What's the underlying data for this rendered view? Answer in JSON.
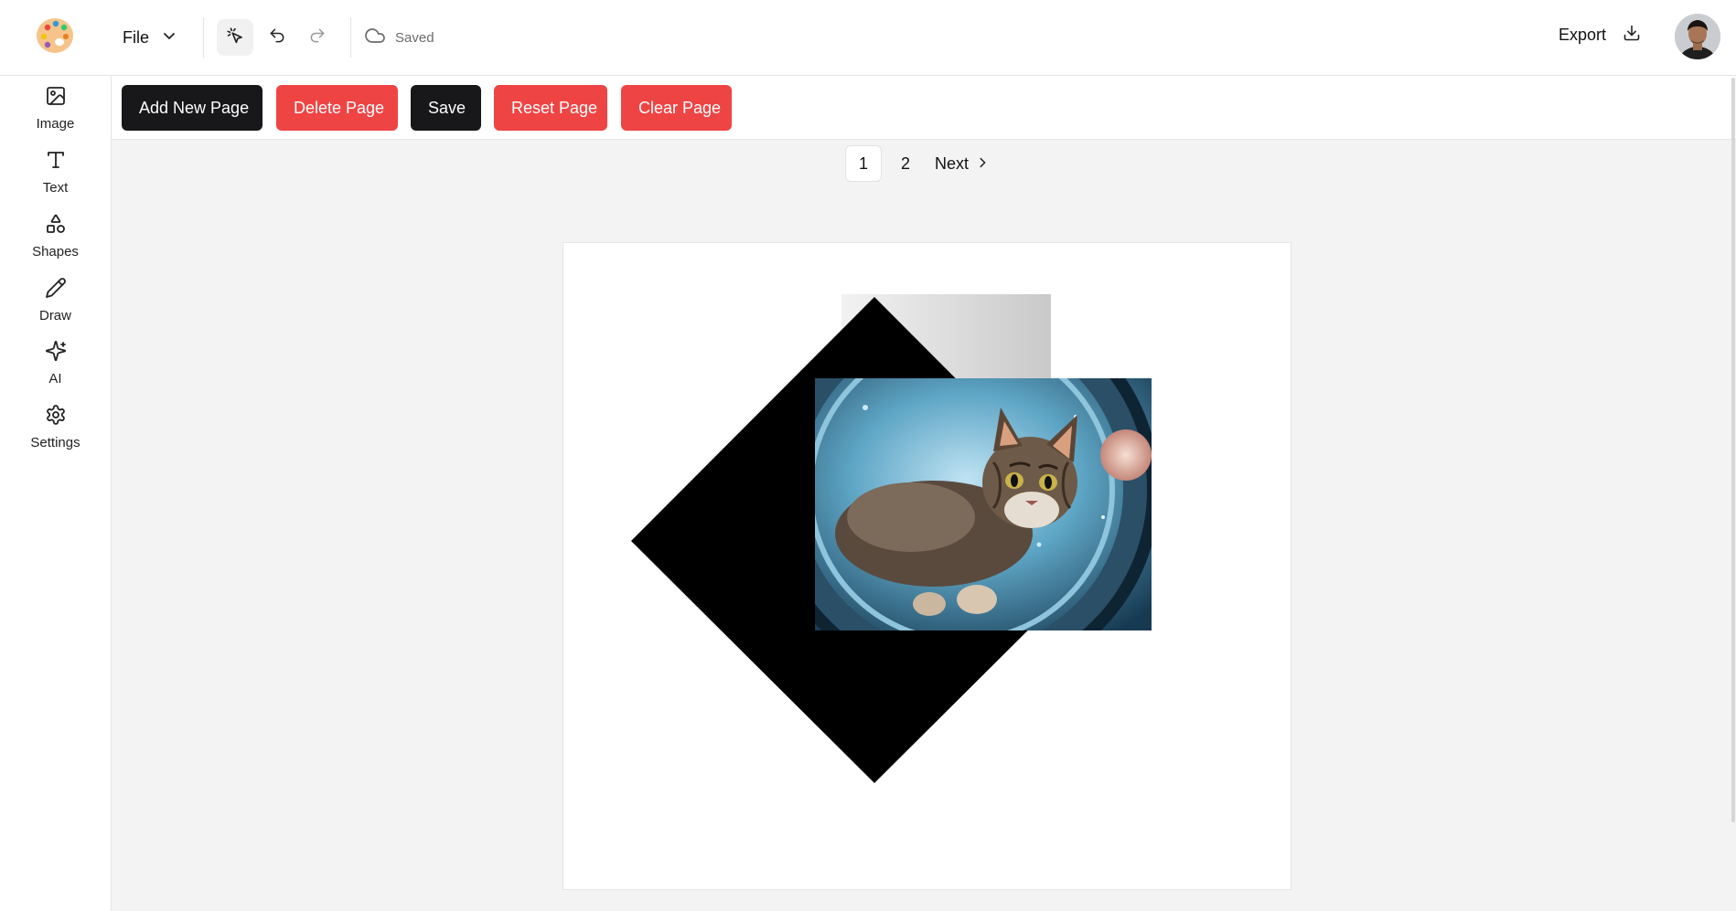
{
  "header": {
    "file_label": "File",
    "save_status": "Saved",
    "export_label": "Export"
  },
  "sidebar": {
    "items": [
      {
        "label": "Image",
        "icon": "image-icon"
      },
      {
        "label": "Text",
        "icon": "text-icon"
      },
      {
        "label": "Shapes",
        "icon": "shapes-icon"
      },
      {
        "label": "Draw",
        "icon": "pencil-icon"
      },
      {
        "label": "AI",
        "icon": "sparkles-icon"
      },
      {
        "label": "Settings",
        "icon": "gear-icon"
      }
    ]
  },
  "toolbar": {
    "add_page": "Add New Page",
    "delete_page": "Delete Page",
    "save": "Save",
    "reset_page": "Reset Page",
    "clear_page": "Clear Page"
  },
  "pagination": {
    "pages": [
      "1",
      "2"
    ],
    "current": "1",
    "next_label": "Next"
  },
  "colors": {
    "primary_dark": "#18181b",
    "danger": "#ef4444",
    "workspace_bg": "#f3f3f3"
  },
  "canvas": {
    "objects": [
      "grey-rectangle",
      "black-diamond",
      "cat-astronaut-image"
    ]
  }
}
